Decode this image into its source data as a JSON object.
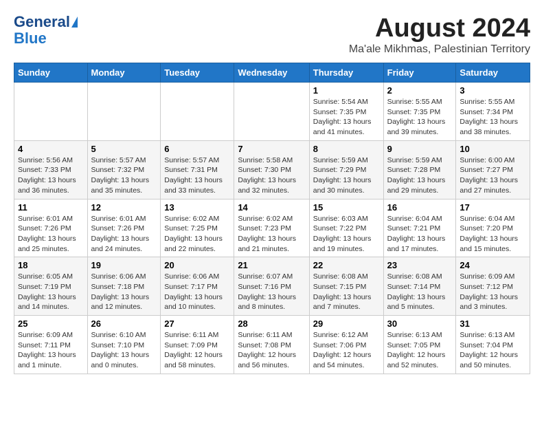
{
  "header": {
    "logo_line1": "General",
    "logo_line2": "Blue",
    "month_year": "August 2024",
    "location": "Ma'ale Mikhmas, Palestinian Territory"
  },
  "days_of_week": [
    "Sunday",
    "Monday",
    "Tuesday",
    "Wednesday",
    "Thursday",
    "Friday",
    "Saturday"
  ],
  "weeks": [
    [
      {
        "day": "",
        "info": ""
      },
      {
        "day": "",
        "info": ""
      },
      {
        "day": "",
        "info": ""
      },
      {
        "day": "",
        "info": ""
      },
      {
        "day": "1",
        "info": "Sunrise: 5:54 AM\nSunset: 7:35 PM\nDaylight: 13 hours\nand 41 minutes."
      },
      {
        "day": "2",
        "info": "Sunrise: 5:55 AM\nSunset: 7:35 PM\nDaylight: 13 hours\nand 39 minutes."
      },
      {
        "day": "3",
        "info": "Sunrise: 5:55 AM\nSunset: 7:34 PM\nDaylight: 13 hours\nand 38 minutes."
      }
    ],
    [
      {
        "day": "4",
        "info": "Sunrise: 5:56 AM\nSunset: 7:33 PM\nDaylight: 13 hours\nand 36 minutes."
      },
      {
        "day": "5",
        "info": "Sunrise: 5:57 AM\nSunset: 7:32 PM\nDaylight: 13 hours\nand 35 minutes."
      },
      {
        "day": "6",
        "info": "Sunrise: 5:57 AM\nSunset: 7:31 PM\nDaylight: 13 hours\nand 33 minutes."
      },
      {
        "day": "7",
        "info": "Sunrise: 5:58 AM\nSunset: 7:30 PM\nDaylight: 13 hours\nand 32 minutes."
      },
      {
        "day": "8",
        "info": "Sunrise: 5:59 AM\nSunset: 7:29 PM\nDaylight: 13 hours\nand 30 minutes."
      },
      {
        "day": "9",
        "info": "Sunrise: 5:59 AM\nSunset: 7:28 PM\nDaylight: 13 hours\nand 29 minutes."
      },
      {
        "day": "10",
        "info": "Sunrise: 6:00 AM\nSunset: 7:27 PM\nDaylight: 13 hours\nand 27 minutes."
      }
    ],
    [
      {
        "day": "11",
        "info": "Sunrise: 6:01 AM\nSunset: 7:26 PM\nDaylight: 13 hours\nand 25 minutes."
      },
      {
        "day": "12",
        "info": "Sunrise: 6:01 AM\nSunset: 7:26 PM\nDaylight: 13 hours\nand 24 minutes."
      },
      {
        "day": "13",
        "info": "Sunrise: 6:02 AM\nSunset: 7:25 PM\nDaylight: 13 hours\nand 22 minutes."
      },
      {
        "day": "14",
        "info": "Sunrise: 6:02 AM\nSunset: 7:23 PM\nDaylight: 13 hours\nand 21 minutes."
      },
      {
        "day": "15",
        "info": "Sunrise: 6:03 AM\nSunset: 7:22 PM\nDaylight: 13 hours\nand 19 minutes."
      },
      {
        "day": "16",
        "info": "Sunrise: 6:04 AM\nSunset: 7:21 PM\nDaylight: 13 hours\nand 17 minutes."
      },
      {
        "day": "17",
        "info": "Sunrise: 6:04 AM\nSunset: 7:20 PM\nDaylight: 13 hours\nand 15 minutes."
      }
    ],
    [
      {
        "day": "18",
        "info": "Sunrise: 6:05 AM\nSunset: 7:19 PM\nDaylight: 13 hours\nand 14 minutes."
      },
      {
        "day": "19",
        "info": "Sunrise: 6:06 AM\nSunset: 7:18 PM\nDaylight: 13 hours\nand 12 minutes."
      },
      {
        "day": "20",
        "info": "Sunrise: 6:06 AM\nSunset: 7:17 PM\nDaylight: 13 hours\nand 10 minutes."
      },
      {
        "day": "21",
        "info": "Sunrise: 6:07 AM\nSunset: 7:16 PM\nDaylight: 13 hours\nand 8 minutes."
      },
      {
        "day": "22",
        "info": "Sunrise: 6:08 AM\nSunset: 7:15 PM\nDaylight: 13 hours\nand 7 minutes."
      },
      {
        "day": "23",
        "info": "Sunrise: 6:08 AM\nSunset: 7:14 PM\nDaylight: 13 hours\nand 5 minutes."
      },
      {
        "day": "24",
        "info": "Sunrise: 6:09 AM\nSunset: 7:12 PM\nDaylight: 13 hours\nand 3 minutes."
      }
    ],
    [
      {
        "day": "25",
        "info": "Sunrise: 6:09 AM\nSunset: 7:11 PM\nDaylight: 13 hours\nand 1 minute."
      },
      {
        "day": "26",
        "info": "Sunrise: 6:10 AM\nSunset: 7:10 PM\nDaylight: 13 hours\nand 0 minutes."
      },
      {
        "day": "27",
        "info": "Sunrise: 6:11 AM\nSunset: 7:09 PM\nDaylight: 12 hours\nand 58 minutes."
      },
      {
        "day": "28",
        "info": "Sunrise: 6:11 AM\nSunset: 7:08 PM\nDaylight: 12 hours\nand 56 minutes."
      },
      {
        "day": "29",
        "info": "Sunrise: 6:12 AM\nSunset: 7:06 PM\nDaylight: 12 hours\nand 54 minutes."
      },
      {
        "day": "30",
        "info": "Sunrise: 6:13 AM\nSunset: 7:05 PM\nDaylight: 12 hours\nand 52 minutes."
      },
      {
        "day": "31",
        "info": "Sunrise: 6:13 AM\nSunset: 7:04 PM\nDaylight: 12 hours\nand 50 minutes."
      }
    ]
  ]
}
